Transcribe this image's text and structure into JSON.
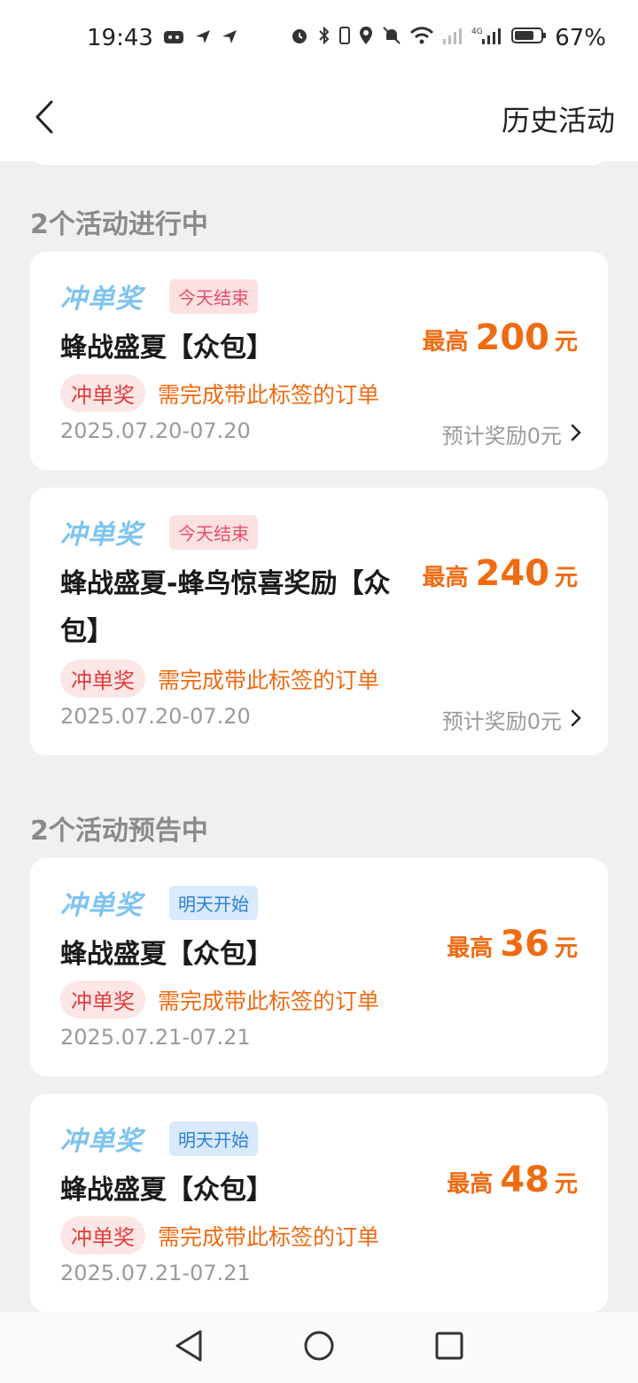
{
  "status": {
    "time": "19:43",
    "battery": "67%"
  },
  "nav": {
    "history_label": "历史活动"
  },
  "sections": {
    "ongoing_title": "2个活动进行中",
    "upcoming_title": "2个活动预告中"
  },
  "cards": [
    {
      "brand": "冲单奖",
      "badge": "今天结束",
      "title": "蜂战盛夏【众包】",
      "reward_prefix": "最高",
      "reward_amount": "200",
      "reward_unit": "元",
      "req_tag": "冲单奖",
      "req_text": "需完成带此标签的订单",
      "date": "2025.07.20-07.20",
      "estimate": "预计奖励0元"
    },
    {
      "brand": "冲单奖",
      "badge": "今天结束",
      "title": "蜂战盛夏-蜂鸟惊喜奖励【众包】",
      "reward_prefix": "最高",
      "reward_amount": "240",
      "reward_unit": "元",
      "req_tag": "冲单奖",
      "req_text": "需完成带此标签的订单",
      "date": "2025.07.20-07.20",
      "estimate": "预计奖励0元"
    },
    {
      "brand": "冲单奖",
      "badge": "明天开始",
      "title": "蜂战盛夏【众包】",
      "reward_prefix": "最高",
      "reward_amount": "36",
      "reward_unit": "元",
      "req_tag": "冲单奖",
      "req_text": "需完成带此标签的订单",
      "date": "2025.07.21-07.21"
    },
    {
      "brand": "冲单奖",
      "badge": "明天开始",
      "title": "蜂战盛夏【众包】",
      "reward_prefix": "最高",
      "reward_amount": "48",
      "reward_unit": "元",
      "req_tag": "冲单奖",
      "req_text": "需完成带此标签的订单",
      "date": "2025.07.21-07.21"
    }
  ],
  "icons": {
    "back": "chevron-left-icon",
    "chevron": "chevron-right-icon"
  },
  "colors": {
    "accent_orange": "#ef6b12",
    "brand_blue": "#7ec3f0",
    "tag_red": "#e23c3c"
  }
}
